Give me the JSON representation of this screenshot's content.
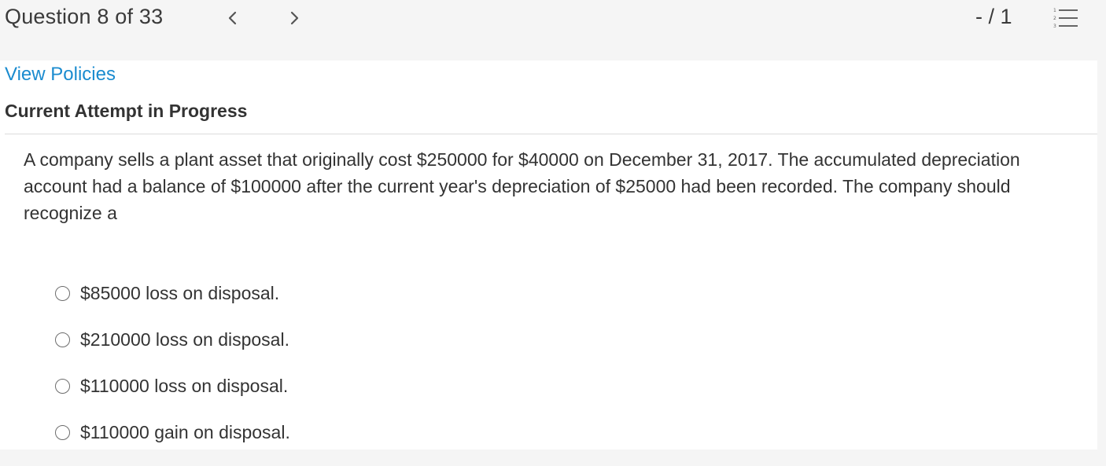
{
  "header": {
    "question_counter": "Question 8 of 33",
    "score": "- / 1"
  },
  "icons": {
    "prev": "chevron-left-icon",
    "next": "chevron-right-icon",
    "list": "numbered-list-icon"
  },
  "panel": {
    "view_policies": "View Policies",
    "attempt_status": "Current Attempt in Progress",
    "question_text": "A company sells a plant asset that originally cost $250000 for $40000 on December 31, 2017. The accumulated depreciation account had a balance of $100000 after the current year's depreciation of $25000 had been recorded. The company should recognize a",
    "options": [
      {
        "label": "$85000 loss on disposal."
      },
      {
        "label": "$210000 loss on disposal."
      },
      {
        "label": "$110000 loss on disposal."
      },
      {
        "label": "$110000 gain on disposal."
      }
    ]
  },
  "colors": {
    "link": "#1a8bcf",
    "background": "#f5f5f5",
    "panel": "#ffffff"
  }
}
